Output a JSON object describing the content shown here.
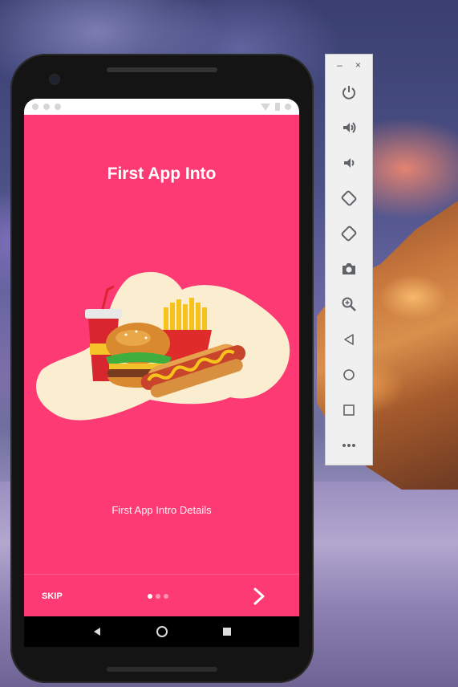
{
  "app": {
    "title": "First App Into",
    "details": "First App Intro Details",
    "skip_label": "SKIP",
    "page_count": 3,
    "active_page": 1,
    "background_color": "#fe3a74"
  },
  "emulator": {
    "minimize_label": "–",
    "close_label": "×",
    "tools": [
      "power-icon",
      "volume-up-icon",
      "volume-down-icon",
      "rotate-left-icon",
      "rotate-right-icon",
      "camera-icon",
      "zoom-icon",
      "back-icon",
      "home-icon",
      "overview-icon",
      "more-icon"
    ]
  },
  "nav": [
    "back-icon",
    "home-icon",
    "recents-icon"
  ]
}
